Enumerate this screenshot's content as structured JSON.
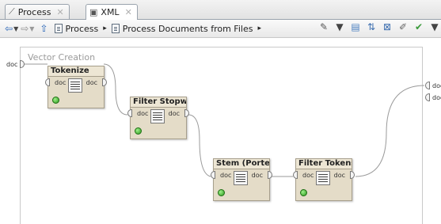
{
  "tabs": [
    {
      "label": "Process",
      "icon": "process-icon",
      "close": "✕",
      "active": false
    },
    {
      "label": "XML",
      "icon": "xml-icon",
      "close": "✕",
      "active": true
    }
  ],
  "toolbar": {
    "breadcrumb": [
      "Process",
      "Process Documents from Files"
    ],
    "breadcrumb_sep": "▸",
    "icons": [
      "back-arrow-icon",
      "forward-arrow-icon",
      "up-arrow-icon",
      "wrench-icon",
      "panel-icon",
      "sort-icon",
      "stop-icon",
      "edit-icon",
      "auto-wire-icon"
    ]
  },
  "canvas": {
    "frame_title": "Vector Creation",
    "outer_left_port": "doc",
    "outer_right_ports": [
      "doc",
      "doc"
    ],
    "operators": [
      {
        "title": "Tokenize",
        "in": "doc",
        "out": "doc"
      },
      {
        "title": "Filter Stopwor...",
        "in": "doc",
        "out": "doc"
      },
      {
        "title": "Stem (Porter)",
        "in": "doc",
        "out": "doc"
      },
      {
        "title": "Filter Tokens ...",
        "in": "doc",
        "out": "doc"
      }
    ]
  },
  "colors": {
    "operator_bg": "#e4dcc8",
    "status_led": "#2c9a1e",
    "accent_arrow": "#2a66b8"
  }
}
